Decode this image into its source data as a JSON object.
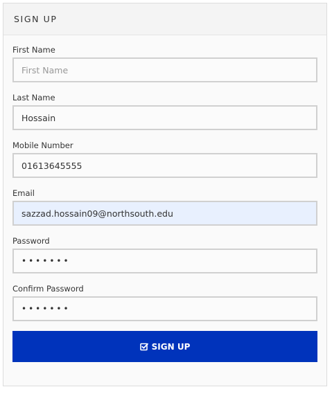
{
  "form": {
    "title": "SIGN UP",
    "fields": [
      {
        "label": "First Name",
        "value": "",
        "placeholder": "First Name",
        "type": "text"
      },
      {
        "label": "Last Name",
        "value": "Hossain",
        "placeholder": "",
        "type": "text"
      },
      {
        "label": "Mobile Number",
        "value": "01613645555",
        "placeholder": "",
        "type": "text"
      },
      {
        "label": "Email",
        "value": "sazzad.hossain09@northsouth.edu",
        "placeholder": "",
        "type": "email"
      },
      {
        "label": "Password",
        "value": "1234567",
        "placeholder": "",
        "type": "password"
      },
      {
        "label": "Confirm Password",
        "value": "1234567",
        "placeholder": "",
        "type": "password"
      }
    ],
    "submit_label": "SIGN UP",
    "submit_icon": "check-square-icon"
  },
  "colors": {
    "button_bg": "#0033bb",
    "button_text": "#ffffff",
    "autofill_bg": "#e8f0fe",
    "input_border": "#d0d0d0"
  }
}
